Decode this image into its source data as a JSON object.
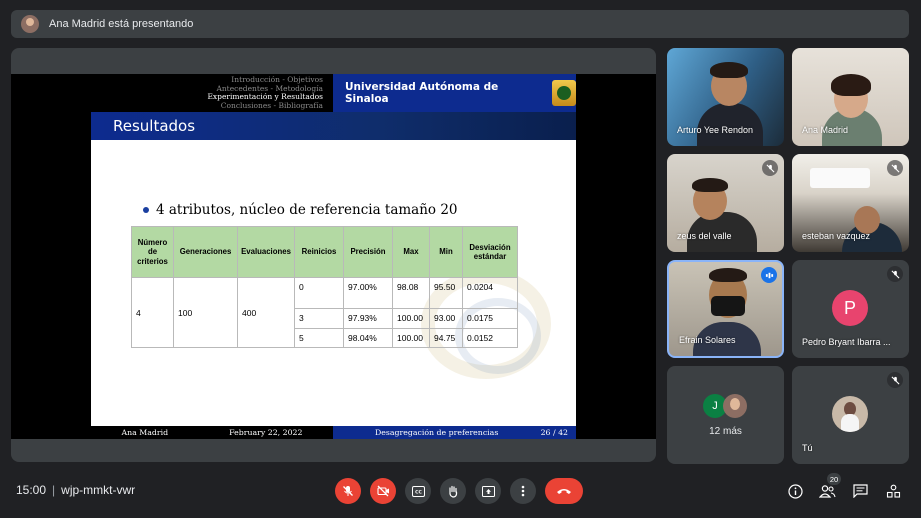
{
  "top_bar": {
    "presenting_text": "Ana Madrid está presentando"
  },
  "slide": {
    "nav_items": [
      {
        "label": "Introducción - Objetivos",
        "active": false
      },
      {
        "label": "Antecedentes - Metodología",
        "active": false
      },
      {
        "label": "Experimentación y Resultados",
        "active": true
      },
      {
        "label": "Conclusiones - Bibliografía",
        "active": false
      }
    ],
    "university": "Universidad Autónoma de Sinaloa",
    "title": "Resultados",
    "bullet": "4 atributos, núcleo de referencia tamaño 20",
    "table": {
      "headers": [
        "Número de criterios",
        "Generaciones",
        "Evaluaciones",
        "Reinicios",
        "Precisión",
        "Max",
        "Min",
        "Desviación estándar"
      ],
      "criterios": "4",
      "generaciones": "100",
      "evaluaciones": "400",
      "rows": [
        [
          "0",
          "97.00%",
          "98.08",
          "95.50",
          "0.0204"
        ],
        [
          "3",
          "97.93%",
          "100.00",
          "93.00",
          "0.0175"
        ],
        [
          "5",
          "98.04%",
          "100.00",
          "94.75",
          "0.0152"
        ]
      ]
    },
    "footer": {
      "author": "Ana Madrid",
      "date": "February 22, 2022",
      "short_title": "Desagregación de preferencias",
      "page": "26 / 42"
    }
  },
  "participants": [
    {
      "name": "Arturo Yee Rendon",
      "muted": false
    },
    {
      "name": "Ana Madrid",
      "muted": false
    },
    {
      "name": "zeus del valle",
      "muted": true
    },
    {
      "name": "esteban vazquez",
      "muted": true
    },
    {
      "name": "Efrain Solares",
      "muted": false,
      "speaking": true
    },
    {
      "name": "Pedro Bryant Ibarra ...",
      "muted": true,
      "initial": "P"
    },
    {
      "more_label": "12 más",
      "initial": "J"
    },
    {
      "name": "Tú",
      "muted": true
    }
  ],
  "bottom_bar": {
    "time": "15:00",
    "meeting_code": "wjp-mmkt-vwr",
    "participant_count": "20"
  },
  "icons": [
    "mic-off-icon",
    "camera-off-icon",
    "captions-icon",
    "raise-hand-icon",
    "present-icon",
    "more-options-icon",
    "end-call-icon",
    "info-icon",
    "people-icon",
    "chat-icon",
    "activities-icon"
  ],
  "colors": {
    "background": "#202124",
    "surface": "#3c4043",
    "danger": "#ea4335",
    "accent": "#1a73e8",
    "slide_blue": "#0d2b8f",
    "table_header": "#b3d9a3"
  }
}
